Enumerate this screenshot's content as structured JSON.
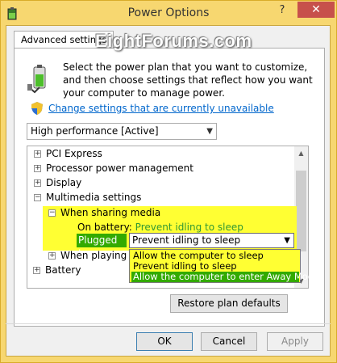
{
  "window": {
    "title": "Power Options",
    "help_label": "?",
    "close_label": "✕"
  },
  "tab": {
    "label": "Advanced settings"
  },
  "watermark": "EightForums.com",
  "description": "Select the power plan that you want to customize, and then choose settings that reflect how you want your computer to manage power.",
  "change_link": "Change settings that are currently unavailable",
  "plan_select": {
    "value": "High performance [Active]"
  },
  "tree": {
    "items": [
      {
        "label": "PCI Express",
        "expander": "+"
      },
      {
        "label": "Processor power management",
        "expander": "+"
      },
      {
        "label": "Display",
        "expander": "+"
      },
      {
        "label": "Multimedia settings",
        "expander": "−"
      },
      {
        "label": "When sharing media",
        "expander": "−"
      },
      {
        "label": "When playing vi",
        "expander": "+"
      },
      {
        "label": "Battery",
        "expander": "+"
      }
    ],
    "on_battery_label": "On battery:",
    "on_battery_value": "Prevent idling to sleep",
    "plugged_in_label": "Plugged in:",
    "plugged_in_value": "Prevent idling to sleep"
  },
  "dropdown_options": [
    "Allow the computer to sleep",
    "Prevent idling to sleep",
    "Allow the computer to enter Away Mode"
  ],
  "buttons": {
    "restore": "Restore plan defaults",
    "ok": "OK",
    "cancel": "Cancel",
    "apply": "Apply"
  },
  "colors": {
    "highlight": "#ffff33",
    "selected_green": "#33aa00",
    "link_blue": "#0066cc",
    "close_red": "#c7504b"
  }
}
